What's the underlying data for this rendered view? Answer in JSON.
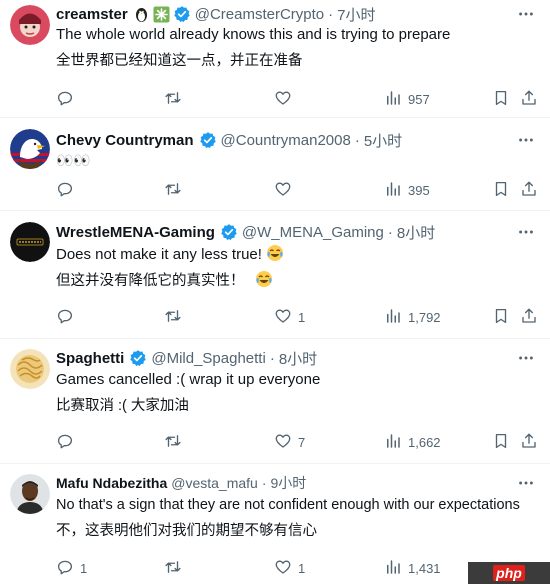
{
  "colors": {
    "verified": "#1d9bf0",
    "muted": "#536471",
    "text": "#0f1419",
    "divider": "#eff3f4"
  },
  "tweets": [
    {
      "name": "creamster",
      "name_emojis": [
        "penguin-emoji",
        "sparkle-emoji"
      ],
      "handle": "@CreamsterCrypto",
      "time": "7小时",
      "lines": [
        "The whole world already knows this and is trying to prepare",
        "全世界都已经知道这一点，并正在准备"
      ],
      "replies": "",
      "reposts": "",
      "likes": "",
      "views": "957"
    },
    {
      "name": "Chevy Countryman",
      "handle": "@Countryman2008",
      "time": "5小时",
      "lines": [
        "👀👀"
      ],
      "replies": "",
      "reposts": "",
      "likes": "",
      "views": "395"
    },
    {
      "name": "WrestleMENA-Gaming",
      "handle": "@W_MENA_Gaming",
      "time": "8小时",
      "lines": [
        "Does not make it any less true!",
        "但这并没有降低它的真实性！"
      ],
      "replies": "",
      "reposts": "",
      "likes": "1",
      "views": "1,792"
    },
    {
      "name": "Spaghetti",
      "handle": "@Mild_Spaghetti",
      "time": "8小时",
      "lines": [
        "Games cancelled :( wrap it up everyone",
        "比赛取消 :( 大家加油"
      ],
      "replies": "",
      "reposts": "",
      "likes": "7",
      "views": "1,662"
    },
    {
      "name": "Mafu Ndabezitha",
      "handle": "@vesta_mafu",
      "time": "9小时",
      "lines": [
        "No that's a sign that they are not confident enough with our expectations",
        "不，这表明他们对我们的期望不够有信心"
      ],
      "replies": "1",
      "reposts": "",
      "likes": "1",
      "views": "1,431"
    }
  ],
  "watermark": "php"
}
